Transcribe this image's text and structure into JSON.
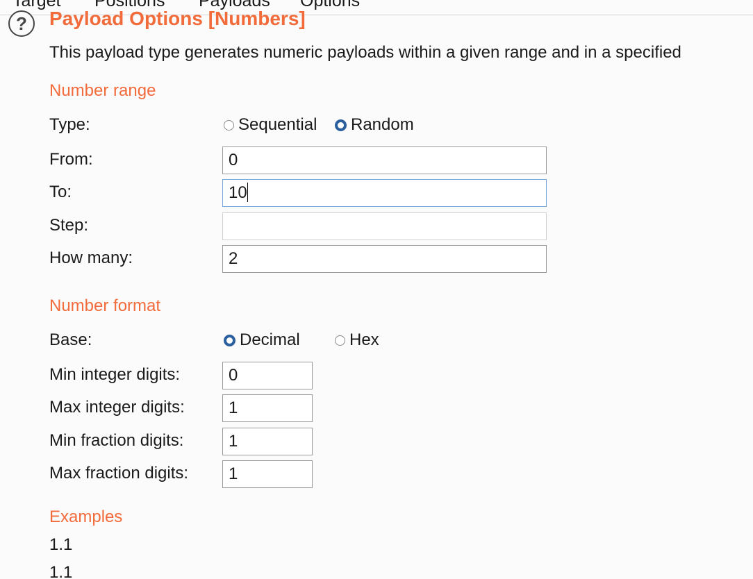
{
  "tabs": [
    {
      "label": "Target"
    },
    {
      "label": "Positions"
    },
    {
      "label": "Payloads"
    },
    {
      "label": "Options"
    }
  ],
  "panel": {
    "title": "Payload Options [Numbers]",
    "description": "This payload type generates numeric payloads within a given range and in a specified"
  },
  "number_range": {
    "heading": "Number range",
    "type_label": "Type:",
    "type_options": [
      "Sequential",
      "Random"
    ],
    "type_selected": "Random",
    "from_label": "From:",
    "from_value": "0",
    "to_label": "To:",
    "to_value": "10",
    "step_label": "Step:",
    "step_value": "",
    "how_many_label": "How many:",
    "how_many_value": "2"
  },
  "number_format": {
    "heading": "Number format",
    "base_label": "Base:",
    "base_options": [
      "Decimal",
      "Hex"
    ],
    "base_selected": "Decimal",
    "min_integer_label": "Min integer digits:",
    "min_integer_value": "0",
    "max_integer_label": "Max integer digits:",
    "max_integer_value": "1",
    "min_fraction_label": "Min fraction digits:",
    "min_fraction_value": "1",
    "max_fraction_label": "Max fraction digits:",
    "max_fraction_value": "1"
  },
  "examples": {
    "heading": "Examples",
    "items": [
      "1.1",
      "1.1"
    ]
  },
  "icons": {
    "help": "help-icon"
  },
  "colors": {
    "accent": "#f26b3a",
    "radio_selected": "#2b5f9e"
  }
}
